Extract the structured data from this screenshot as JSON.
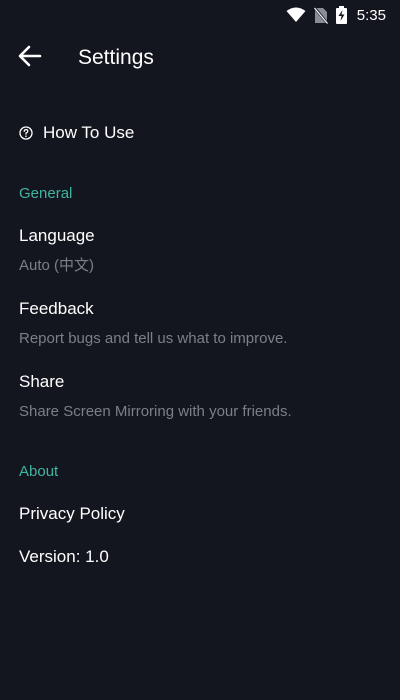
{
  "status_bar": {
    "time": "5:35",
    "icons": [
      "wifi-icon",
      "no-sim-icon",
      "battery-charging-icon"
    ]
  },
  "app_bar": {
    "back_icon": "arrow-left-icon",
    "title": "Settings"
  },
  "how_to_use": {
    "icon": "help-circle-icon",
    "label": "How To Use"
  },
  "sections": {
    "general": {
      "header": "General",
      "language": {
        "title": "Language",
        "subtitle": "Auto (中文)"
      },
      "feedback": {
        "title": "Feedback",
        "subtitle": "Report bugs and tell us what to improve."
      },
      "share": {
        "title": "Share",
        "subtitle": "Share Screen Mirroring with your friends."
      }
    },
    "about": {
      "header": "About",
      "privacy_policy": {
        "title": "Privacy Policy"
      },
      "version": {
        "title": "Version: 1.0"
      }
    }
  },
  "colors": {
    "background": "#14161f",
    "accent": "#3fb5a0",
    "primary_text": "#ffffff",
    "secondary_text": "#7c7f88"
  }
}
